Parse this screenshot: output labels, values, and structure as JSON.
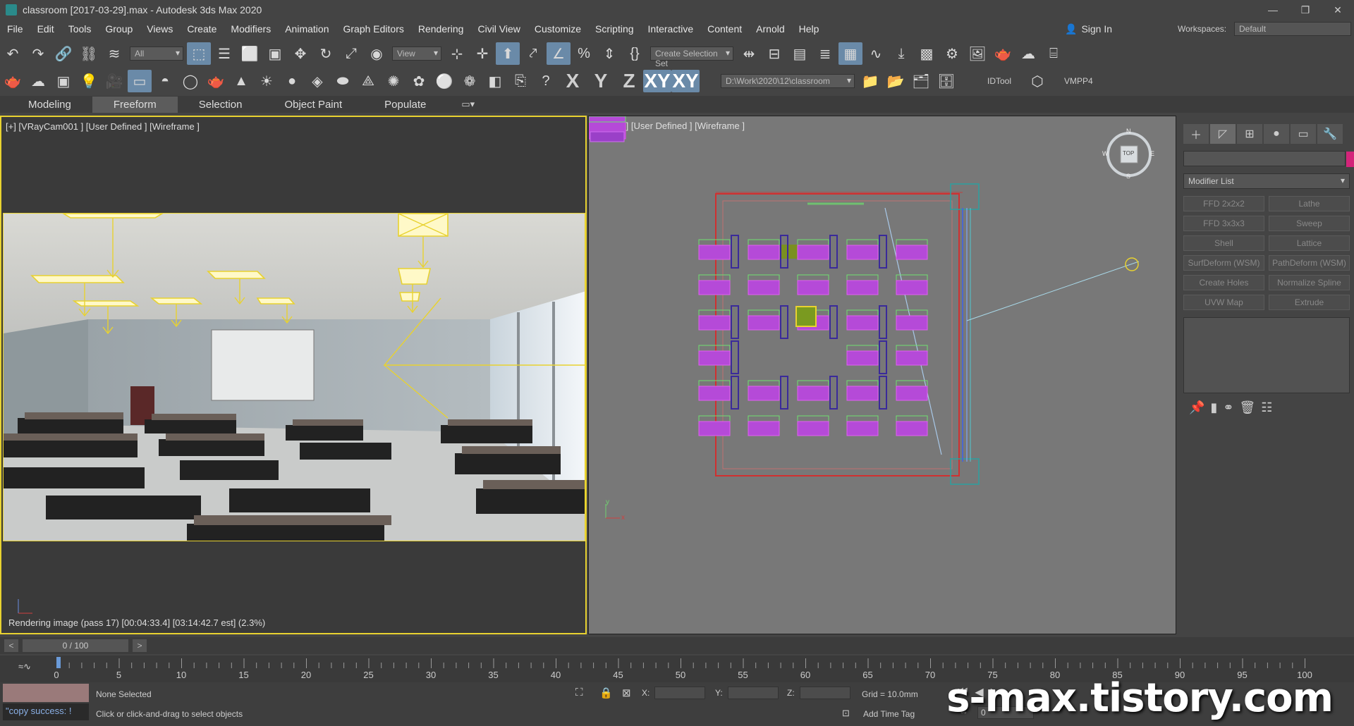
{
  "window": {
    "title": "classroom [2017-03-29].max - Autodesk 3ds Max 2020",
    "min": "—",
    "max": "❐",
    "close": "✕"
  },
  "menu": [
    "File",
    "Edit",
    "Tools",
    "Group",
    "Views",
    "Create",
    "Modifiers",
    "Animation",
    "Graph Editors",
    "Rendering",
    "Civil View",
    "Customize",
    "Scripting",
    "Interactive",
    "Content",
    "Arnold",
    "Help"
  ],
  "account": {
    "signin": "Sign In",
    "workspaces_label": "Workspaces:",
    "workspace": "Default"
  },
  "toolbar": {
    "filter": "All",
    "refcoord": "View",
    "selset": "Create Selection Set",
    "path": "D:\\Work\\2020\\12\\classroom",
    "idtool": "IDTool",
    "vmpp": "VMPP4",
    "axes": [
      "X",
      "Y",
      "Z",
      "XY",
      "XY"
    ]
  },
  "ribbon_tabs": [
    "Modeling",
    "Freeform",
    "Selection",
    "Object Paint",
    "Populate"
  ],
  "viewports": {
    "left_label": "[+] [VRayCam001 ] [User Defined ] [Wireframe ]",
    "right_label": "[+] [Top ] [User Defined ] [Wireframe ]",
    "render_status": "Rendering image (pass 17) [00:04:33.4] [03:14:42.7 est]    (2.3%)",
    "viewcube": {
      "top": "TOP",
      "n": "N",
      "s": "S",
      "w": "W",
      "e": "E"
    },
    "axis_x": "x",
    "axis_y": "y"
  },
  "command_panel": {
    "modifier_list": "Modifier List",
    "modifiers": [
      "FFD 2x2x2",
      "Lathe",
      "FFD 3x3x3",
      "Sweep",
      "Shell",
      "Lattice",
      "SurfDeform (WSM)",
      "PathDeform (WSM)",
      "Create Holes",
      "Normalize Spline",
      "UVW Map",
      "Extrude"
    ],
    "swatch_color": "#d4247a"
  },
  "timeline": {
    "frame": "0 / 100",
    "prev": "<",
    "next": ">",
    "ticks": [
      "0",
      "5",
      "10",
      "15",
      "20",
      "25",
      "30",
      "35",
      "40",
      "45",
      "50",
      "55",
      "60",
      "65",
      "70",
      "75",
      "80",
      "85",
      "90",
      "95",
      "100"
    ]
  },
  "status": {
    "selection": "None Selected",
    "prompt": "Click or click-and-drag to select objects",
    "listener": "\"copy success: !",
    "x_label": "X:",
    "y_label": "Y:",
    "z_label": "Z:",
    "grid": "Grid = 10.0mm",
    "add_time_tag": "Add Time Tag",
    "frame_value": "0"
  },
  "watermark": "s-max.tistory.com"
}
